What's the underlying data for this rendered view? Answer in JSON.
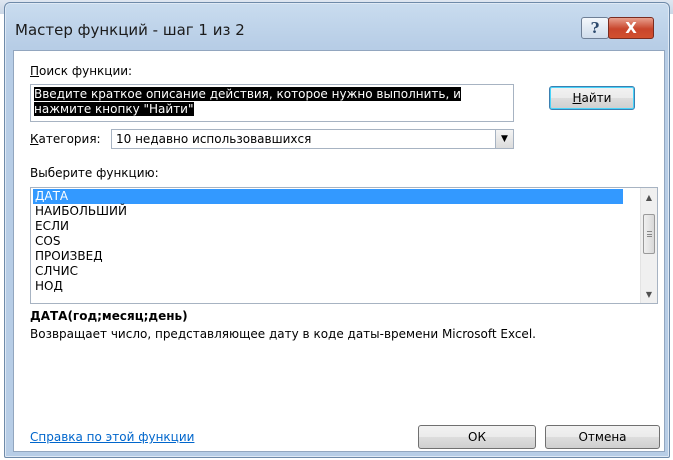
{
  "dialog": {
    "title": "Мастер функций - шаг 1 из 2",
    "help_icon": "?",
    "close_icon": "X",
    "search": {
      "label": "Поиск функции:",
      "value": "Введите краткое описание действия, которое нужно выполнить, и нажмите кнопку \"Найти\"",
      "find_button": "Найти"
    },
    "category": {
      "label": "Категория:",
      "value": "10 недавно использовавшихся"
    },
    "function_list": {
      "label": "Выберите функцию:",
      "items": [
        "ДАТА",
        "НАИБОЛЬШИЙ",
        "ЕСЛИ",
        "COS",
        "ПРОИЗВЕД",
        "СЛЧИС",
        "НОД"
      ],
      "selected_index": 0
    },
    "selected_function": {
      "signature": "ДАТА(год;месяц;день)",
      "description": "Возвращает число, представляющее дату в коде даты-времени Microsoft Excel."
    },
    "help_link": "Справка по этой функции",
    "ok_button": "ОК",
    "cancel_button": "Отмена"
  },
  "colors": {
    "selection": "#3399ff",
    "link": "#0066cc",
    "close_button": "#c8452c"
  }
}
